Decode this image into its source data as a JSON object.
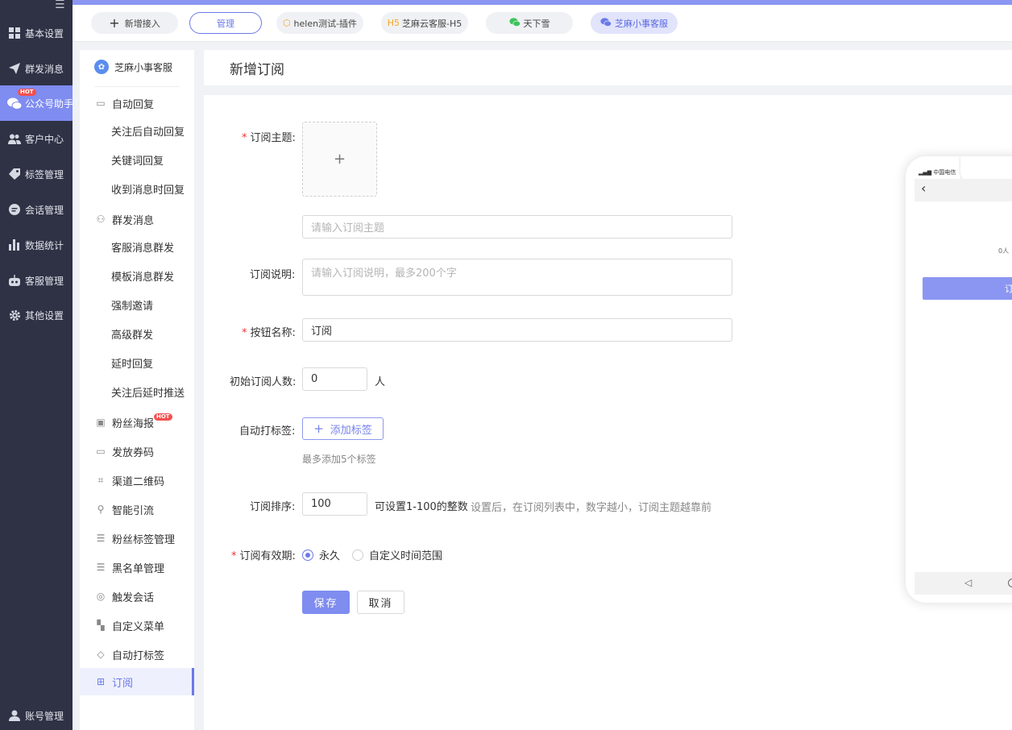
{
  "nav": {
    "items": [
      {
        "label": "基本设置",
        "icon": "grid-icon"
      },
      {
        "label": "群发消息",
        "icon": "paper-plane-icon"
      },
      {
        "label": "公众号助手",
        "icon": "wechat-icon",
        "badge": "HOT",
        "active": true
      },
      {
        "label": "客户中心",
        "icon": "users-icon"
      },
      {
        "label": "标签管理",
        "icon": "tag-icon"
      },
      {
        "label": "会话管理",
        "icon": "chat-icon"
      },
      {
        "label": "数据统计",
        "icon": "bar-chart-icon"
      },
      {
        "label": "客服管理",
        "icon": "robot-icon"
      },
      {
        "label": "其他设置",
        "icon": "gear-icon"
      }
    ],
    "account": {
      "label": "账号管理",
      "icon": "user-icon"
    }
  },
  "topbar": {
    "tabs": [
      {
        "label": "新增接入",
        "icon": "plus-icon"
      },
      {
        "label": "管理"
      },
      {
        "label": "helen测试-插件",
        "icon": "cube-icon"
      },
      {
        "label": "芝麻云客服-H5",
        "icon": "h5-icon",
        "prefix": "H5"
      },
      {
        "label": "天下雪",
        "icon": "wechat-icon"
      },
      {
        "label": "芝麻小事客服",
        "icon": "wechat-icon"
      }
    ]
  },
  "sidebar": {
    "brand": "芝麻小事客服",
    "items": [
      {
        "label": "自动回复",
        "type": "group",
        "icon": "message-square-icon"
      },
      {
        "label": "关注后自动回复",
        "type": "sub"
      },
      {
        "label": "关键词回复",
        "type": "sub"
      },
      {
        "label": "收到消息时回复",
        "type": "sub"
      },
      {
        "label": "群发消息",
        "type": "group",
        "icon": "users-outline-icon"
      },
      {
        "label": "客服消息群发",
        "type": "sub"
      },
      {
        "label": "模板消息群发",
        "type": "sub"
      },
      {
        "label": "强制邀请",
        "type": "sub"
      },
      {
        "label": "高级群发",
        "type": "sub"
      },
      {
        "label": "延时回复",
        "type": "sub"
      },
      {
        "label": "关注后延时推送",
        "type": "sub"
      },
      {
        "label": "粉丝海报",
        "type": "group",
        "icon": "poster-icon",
        "badge": "HOT"
      },
      {
        "label": "发放券码",
        "type": "group",
        "icon": "ticket-icon"
      },
      {
        "label": "渠道二维码",
        "type": "group",
        "icon": "qrcode-icon"
      },
      {
        "label": "智能引流",
        "type": "group",
        "icon": "user-flow-icon"
      },
      {
        "label": "粉丝标签管理",
        "type": "group",
        "icon": "list-icon"
      },
      {
        "label": "黑名单管理",
        "type": "group",
        "icon": "list-icon"
      },
      {
        "label": "触发会话",
        "type": "group",
        "icon": "signal-icon"
      },
      {
        "label": "自定义菜单",
        "type": "group",
        "icon": "menu-grid-icon"
      },
      {
        "label": "自动打标签",
        "type": "group",
        "icon": "tag-outline-icon"
      },
      {
        "label": "订阅",
        "type": "group",
        "icon": "subscribe-icon",
        "active": true
      }
    ]
  },
  "page": {
    "title": "新增订阅"
  },
  "form": {
    "topic_label": "订阅主题",
    "upload_plus": "+",
    "topic_placeholder": "请输入订阅主题",
    "desc_label": "订阅说明",
    "desc_placeholder": "请输入订阅说明，最多200个字",
    "button_name_label": "按钮名称",
    "button_name_value": "订阅",
    "initial_count_label": "初始订阅人数",
    "initial_count_value": "0",
    "initial_count_unit": "人",
    "auto_tag_label": "自动打标签",
    "add_tag_button": "添加标签",
    "add_tag_hint": "最多添加5个标签",
    "sort_label": "订阅排序",
    "sort_value": "100",
    "sort_range_hint": "可设置1-100的整数",
    "sort_desc_hint": "设置后，在订阅列表中，数字越小，订阅主题越靠前",
    "validity_label": "订阅有效期",
    "validity_options": [
      "永久",
      "自定义时间范围"
    ],
    "validity_selected": "永久",
    "save_button": "保存",
    "cancel_button": "取消",
    "colon": ":"
  },
  "preview": {
    "carrier": "中国电信",
    "count_text": "0人",
    "subscribe_button": "订"
  },
  "colors": {
    "accent": "#7f8cf0",
    "nav_bg": "#2f3245",
    "required": "#e33333"
  }
}
